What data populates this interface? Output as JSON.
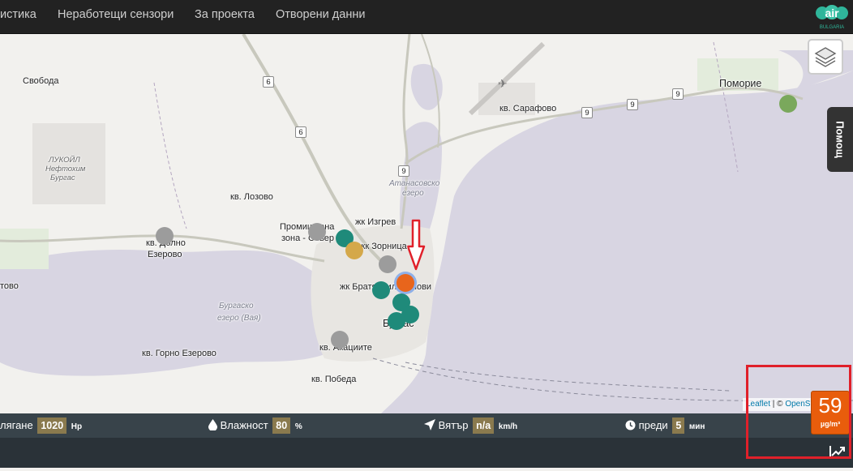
{
  "nav": {
    "items": [
      "истика",
      "Неработещи сензори",
      "За проекта",
      "Отворени данни"
    ],
    "logo_text": "air",
    "logo_subtext": "BULGARIA"
  },
  "map": {
    "places": {
      "pomorie": "Поморие",
      "svoboda": "Свобода",
      "sarafovo": "кв. Сарафово",
      "lozovo": "кв. Лозово",
      "izgrev": "жк Изгрев",
      "promishlena": "Промишлена",
      "zona_sever": "зона - Север",
      "zornitsa": "жк Зорница",
      "dolno_ezerovo_1": "кв. Долно",
      "dolno_ezerovo_2": "Езерово",
      "bratya": "жк Братя Миладинови",
      "burgas": "Бургас",
      "gorno_ezerovo": "кв. Горно Езерово",
      "akatsiite": "кв. Акациите",
      "pobeda": "кв. Победа",
      "vetren_part": "тово"
    },
    "water": {
      "atanasovsko_1": "Атанасовско",
      "atanasovsko_2": "езеро",
      "burgasko_1": "Бургаско",
      "burgasko_2": "езеро (Вая)"
    },
    "poi": {
      "lukoil_1": "ЛУКОЙЛ",
      "lukoil_2": "Нефтохим",
      "lukoil_3": "Бургас"
    },
    "road_shields": [
      "6",
      "6",
      "9",
      "9",
      "9",
      "9"
    ],
    "sensor_colors": {
      "good": "#1f8a7a",
      "moderate": "#d4a84a",
      "bad": "#e8651c",
      "offline": "#9c9c9c",
      "light_green": "#7aa85c"
    },
    "layers_icon": "layers-icon",
    "help_label": "Помощ",
    "attribution_leaflet": "Leaflet",
    "attribution_sep": " | © ",
    "attribution_osm": "OpenS"
  },
  "info": {
    "pressure_label": "лягане",
    "pressure_value": "1020",
    "pressure_unit": "Hp",
    "humidity_label": "Влажност",
    "humidity_value": "80",
    "humidity_unit": "%",
    "wind_label": "Вятър",
    "wind_value": "n/a",
    "wind_unit": "km/h",
    "time_label": "преди",
    "time_value": "5",
    "time_unit": "мин"
  },
  "aqi": {
    "value": "59",
    "unit": "µg/m³",
    "color": "#e85d0c"
  },
  "colors": {
    "annotation": "#e0202a",
    "navbar": "#222222",
    "infobar": "#38434a"
  }
}
